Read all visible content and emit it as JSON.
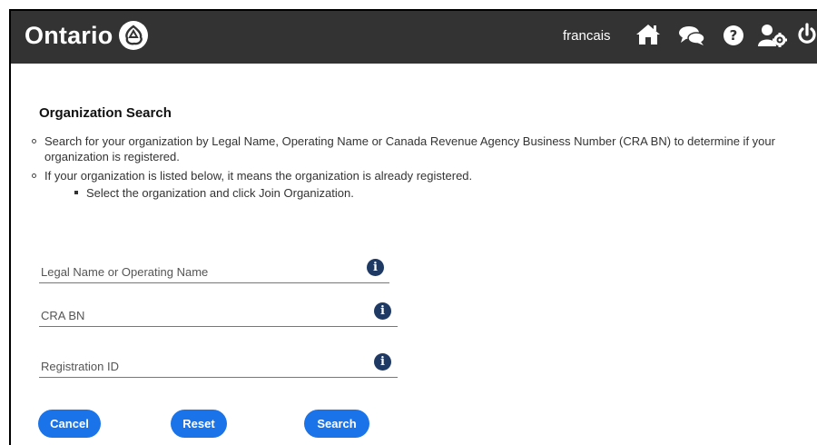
{
  "header": {
    "logo_text": "Ontario",
    "language_link": "francais",
    "icons": [
      "home-icon",
      "chat-icon",
      "help-icon",
      "user-settings-icon",
      "power-icon"
    ],
    "bg_color": "#333333"
  },
  "page": {
    "title": "Organization Search",
    "bullets": [
      "Search for your organization by Legal Name, Operating Name or Canada Revenue Agency Business Number (CRA BN) to determine if your organization is registered.",
      "If your organization is listed below, it means the organization is already registered."
    ],
    "sub_bullet": "Select the organization and click Join Organization."
  },
  "form": {
    "name_placeholder": "Legal Name or Operating Name",
    "cra_placeholder": "CRA BN",
    "reg_placeholder": "Registration ID",
    "info_glyph": "i"
  },
  "buttons": {
    "cancel": "Cancel",
    "reset": "Reset",
    "search": "Search",
    "color": "#1a73e8"
  }
}
